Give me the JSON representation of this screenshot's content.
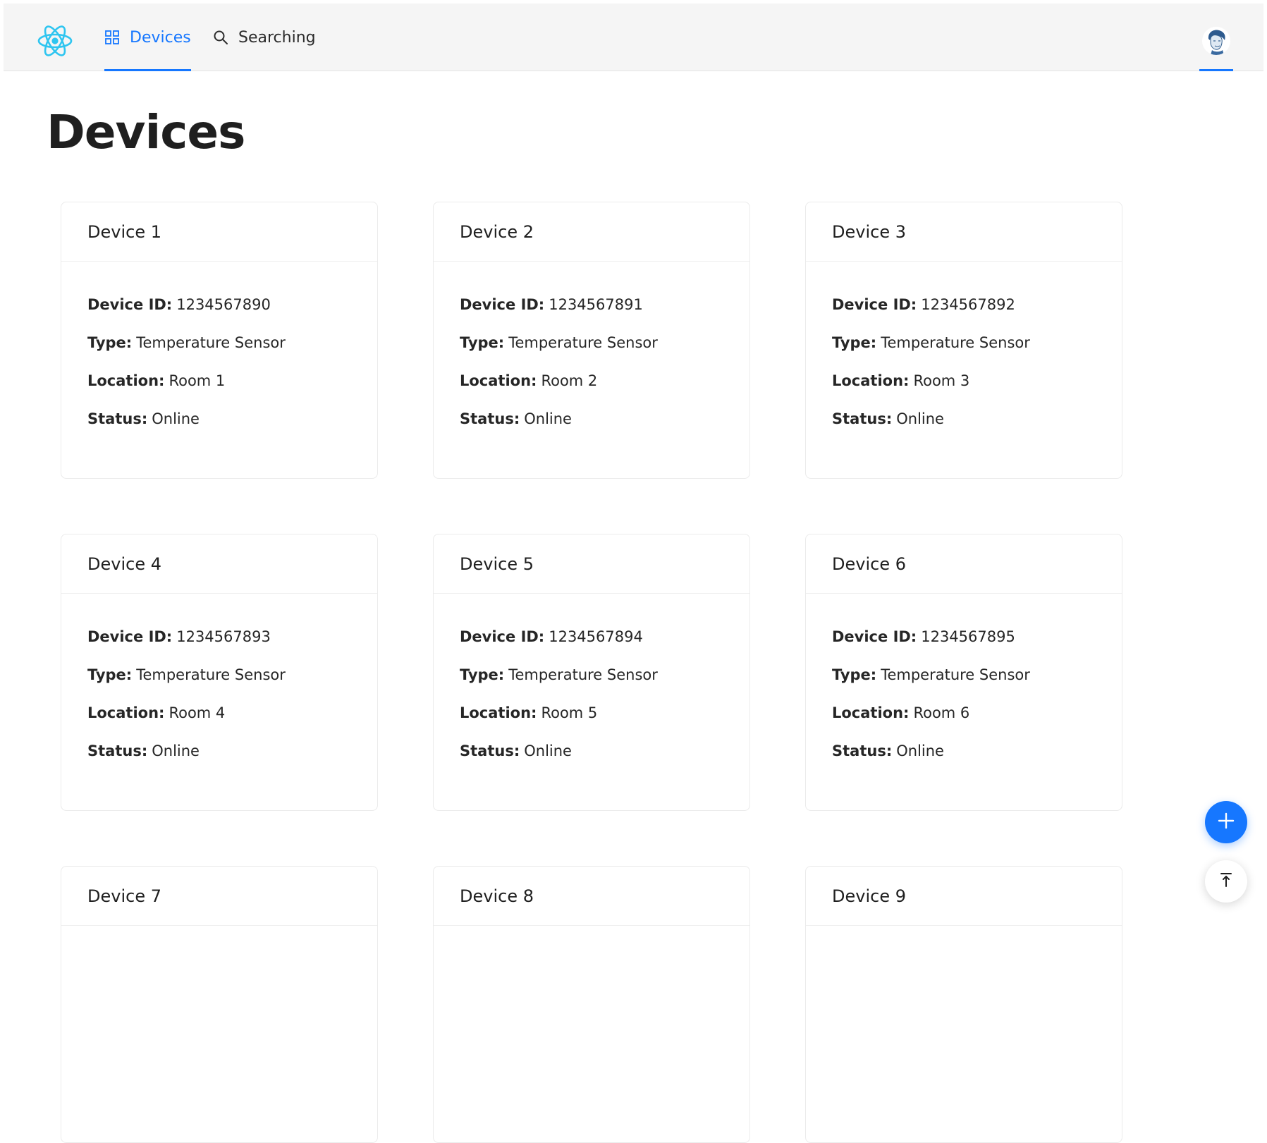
{
  "header": {
    "logo_icon": "react-logo-icon",
    "nav": [
      {
        "label": "Devices",
        "icon": "appstore-icon",
        "active": true
      },
      {
        "label": "Searching",
        "icon": "search-icon",
        "active": false
      }
    ],
    "avatar_icon": "user-avatar"
  },
  "page": {
    "title": "Devices"
  },
  "labels": {
    "device_id": "Device ID:",
    "type": "Type:",
    "location": "Location:",
    "status": "Status:"
  },
  "devices": [
    {
      "name": "Device 1",
      "id": "1234567890",
      "type": "Temperature Sensor",
      "location": "Room 1",
      "status": "Online"
    },
    {
      "name": "Device 2",
      "id": "1234567891",
      "type": "Temperature Sensor",
      "location": "Room 2",
      "status": "Online"
    },
    {
      "name": "Device 3",
      "id": "1234567892",
      "type": "Temperature Sensor",
      "location": "Room 3",
      "status": "Online"
    },
    {
      "name": "Device 4",
      "id": "1234567893",
      "type": "Temperature Sensor",
      "location": "Room 4",
      "status": "Online"
    },
    {
      "name": "Device 5",
      "id": "1234567894",
      "type": "Temperature Sensor",
      "location": "Room 5",
      "status": "Online"
    },
    {
      "name": "Device 6",
      "id": "1234567895",
      "type": "Temperature Sensor",
      "location": "Room 6",
      "status": "Online"
    },
    {
      "name": "Device 7"
    },
    {
      "name": "Device 8"
    },
    {
      "name": "Device 9"
    }
  ],
  "fab": {
    "add_icon": "plus-icon",
    "top_icon": "back-to-top-icon"
  },
  "colors": {
    "accent": "#1677ff",
    "header_bg": "#f5f5f5",
    "logo": "#2ec5f0"
  }
}
